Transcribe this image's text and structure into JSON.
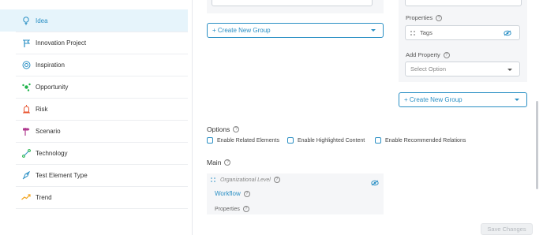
{
  "sidebar": {
    "items": [
      {
        "label": "Idea",
        "icon": "lightbulb-icon",
        "active": true
      },
      {
        "label": "Innovation Project",
        "icon": "flag-icon"
      },
      {
        "label": "Inspiration",
        "icon": "target-icon"
      },
      {
        "label": "Opportunity",
        "icon": "network-icon"
      },
      {
        "label": "Risk",
        "icon": "alarm-icon"
      },
      {
        "label": "Scenario",
        "icon": "signpost-icon"
      },
      {
        "label": "Technology",
        "icon": "circuit-icon"
      },
      {
        "label": "Test Element Type",
        "icon": "rocket-icon"
      },
      {
        "label": "Trend",
        "icon": "trend-icon"
      }
    ]
  },
  "left_column": {
    "create_group_label": "+ Create New Group",
    "options": {
      "heading": "Options",
      "checkboxes": [
        {
          "label": "Enable Related Elements",
          "checked": false
        },
        {
          "label": "Enable Highlighted Content",
          "checked": false
        },
        {
          "label": "Enable Recommended Relations",
          "checked": false
        }
      ]
    },
    "main_section": {
      "heading": "Main",
      "field_label": "Organizational Level",
      "group_name": "Workflow",
      "properties_label": "Properties"
    }
  },
  "right_column": {
    "properties_label": "Properties",
    "tag_item": "Tags",
    "add_property_label": "Add Property",
    "select_placeholder": "Select Option",
    "create_group_label": "+ Create New Group"
  },
  "footer": {
    "save_label": "Save Changes"
  },
  "colors": {
    "accent": "#2a8fc4",
    "active_bg": "#e6f4fb",
    "panel_bg": "#f5f6f8"
  }
}
